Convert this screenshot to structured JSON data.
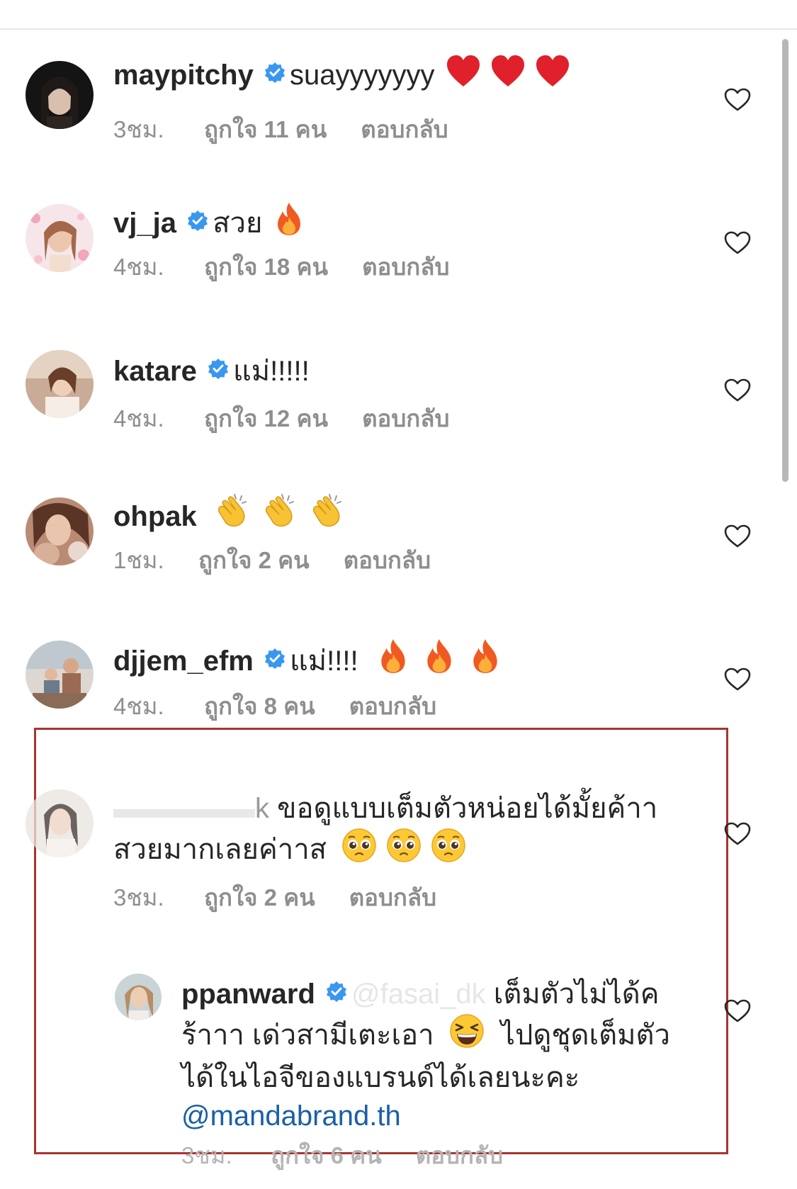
{
  "colors": {
    "text": "#262626",
    "meta": "#8e8e8e",
    "verified": "#3897f0",
    "highlight_box": "#a8342f",
    "link": "#1a5fa8"
  },
  "comments": [
    {
      "username": "maypitchy",
      "verified": true,
      "text": "suayyyyyyy",
      "emojis": [
        "red-heart-emoji",
        "red-heart-emoji",
        "red-heart-emoji"
      ],
      "time": "3ชม.",
      "likes": "ถูกใจ 11 คน",
      "reply": "ตอบกลับ"
    },
    {
      "username": "vj_ja",
      "verified": true,
      "text": "สวย",
      "emojis": [
        "fire-emoji"
      ],
      "time": "4ชม.",
      "likes": "ถูกใจ 18 คน",
      "reply": "ตอบกลับ"
    },
    {
      "username": "katare",
      "verified": true,
      "text": "แม่!!!!!",
      "emojis": [],
      "time": "4ชม.",
      "likes": "ถูกใจ 12 คน",
      "reply": "ตอบกลับ"
    },
    {
      "username": "ohpak",
      "verified": false,
      "text": "",
      "emojis": [
        "clapping-hands-emoji",
        "clapping-hands-emoji",
        "clapping-hands-emoji"
      ],
      "time": "1ชม.",
      "likes": "ถูกใจ 2 คน",
      "reply": "ตอบกลับ"
    },
    {
      "username": "djjem_efm",
      "verified": true,
      "text": "แม่!!!!",
      "emojis": [
        "fire-emoji",
        "fire-emoji",
        "fire-emoji"
      ],
      "time": "4ชม.",
      "likes": "ถูกใจ 8 คน",
      "reply": "ตอบกลับ"
    }
  ],
  "highlighted": {
    "comment": {
      "username_fragment": "k",
      "line1": "ขอดูแบบเต็มตัวหน่อยได้มั้ยค้าา",
      "line2": "สวยมากเลยค่าาส",
      "emojis": [
        "pleading-face-emoji",
        "pleading-face-emoji",
        "pleading-face-emoji"
      ],
      "time": "3ชม.",
      "likes": "ถูกใจ 2 คน",
      "reply": "ตอบกลับ"
    },
    "reply": {
      "username": "ppanward",
      "verified": true,
      "mention": "@fasai_dk",
      "line1": "เต็มตัวไม่ได้ค",
      "line2a": "ร้าาา เด่วสามีเตะเอา",
      "line2_emoji": "grinning-squinting-face-emoji",
      "line2b": "ไปดูชุดเต็มตัว",
      "line3": "ได้ในไอจีของแบรนด์ได้เลยนะคะ",
      "link": "@mandabrand.th",
      "time": "3ชม.",
      "likes": "ถูกใจ 6 คน",
      "reply": "ตอบกลับ"
    }
  }
}
